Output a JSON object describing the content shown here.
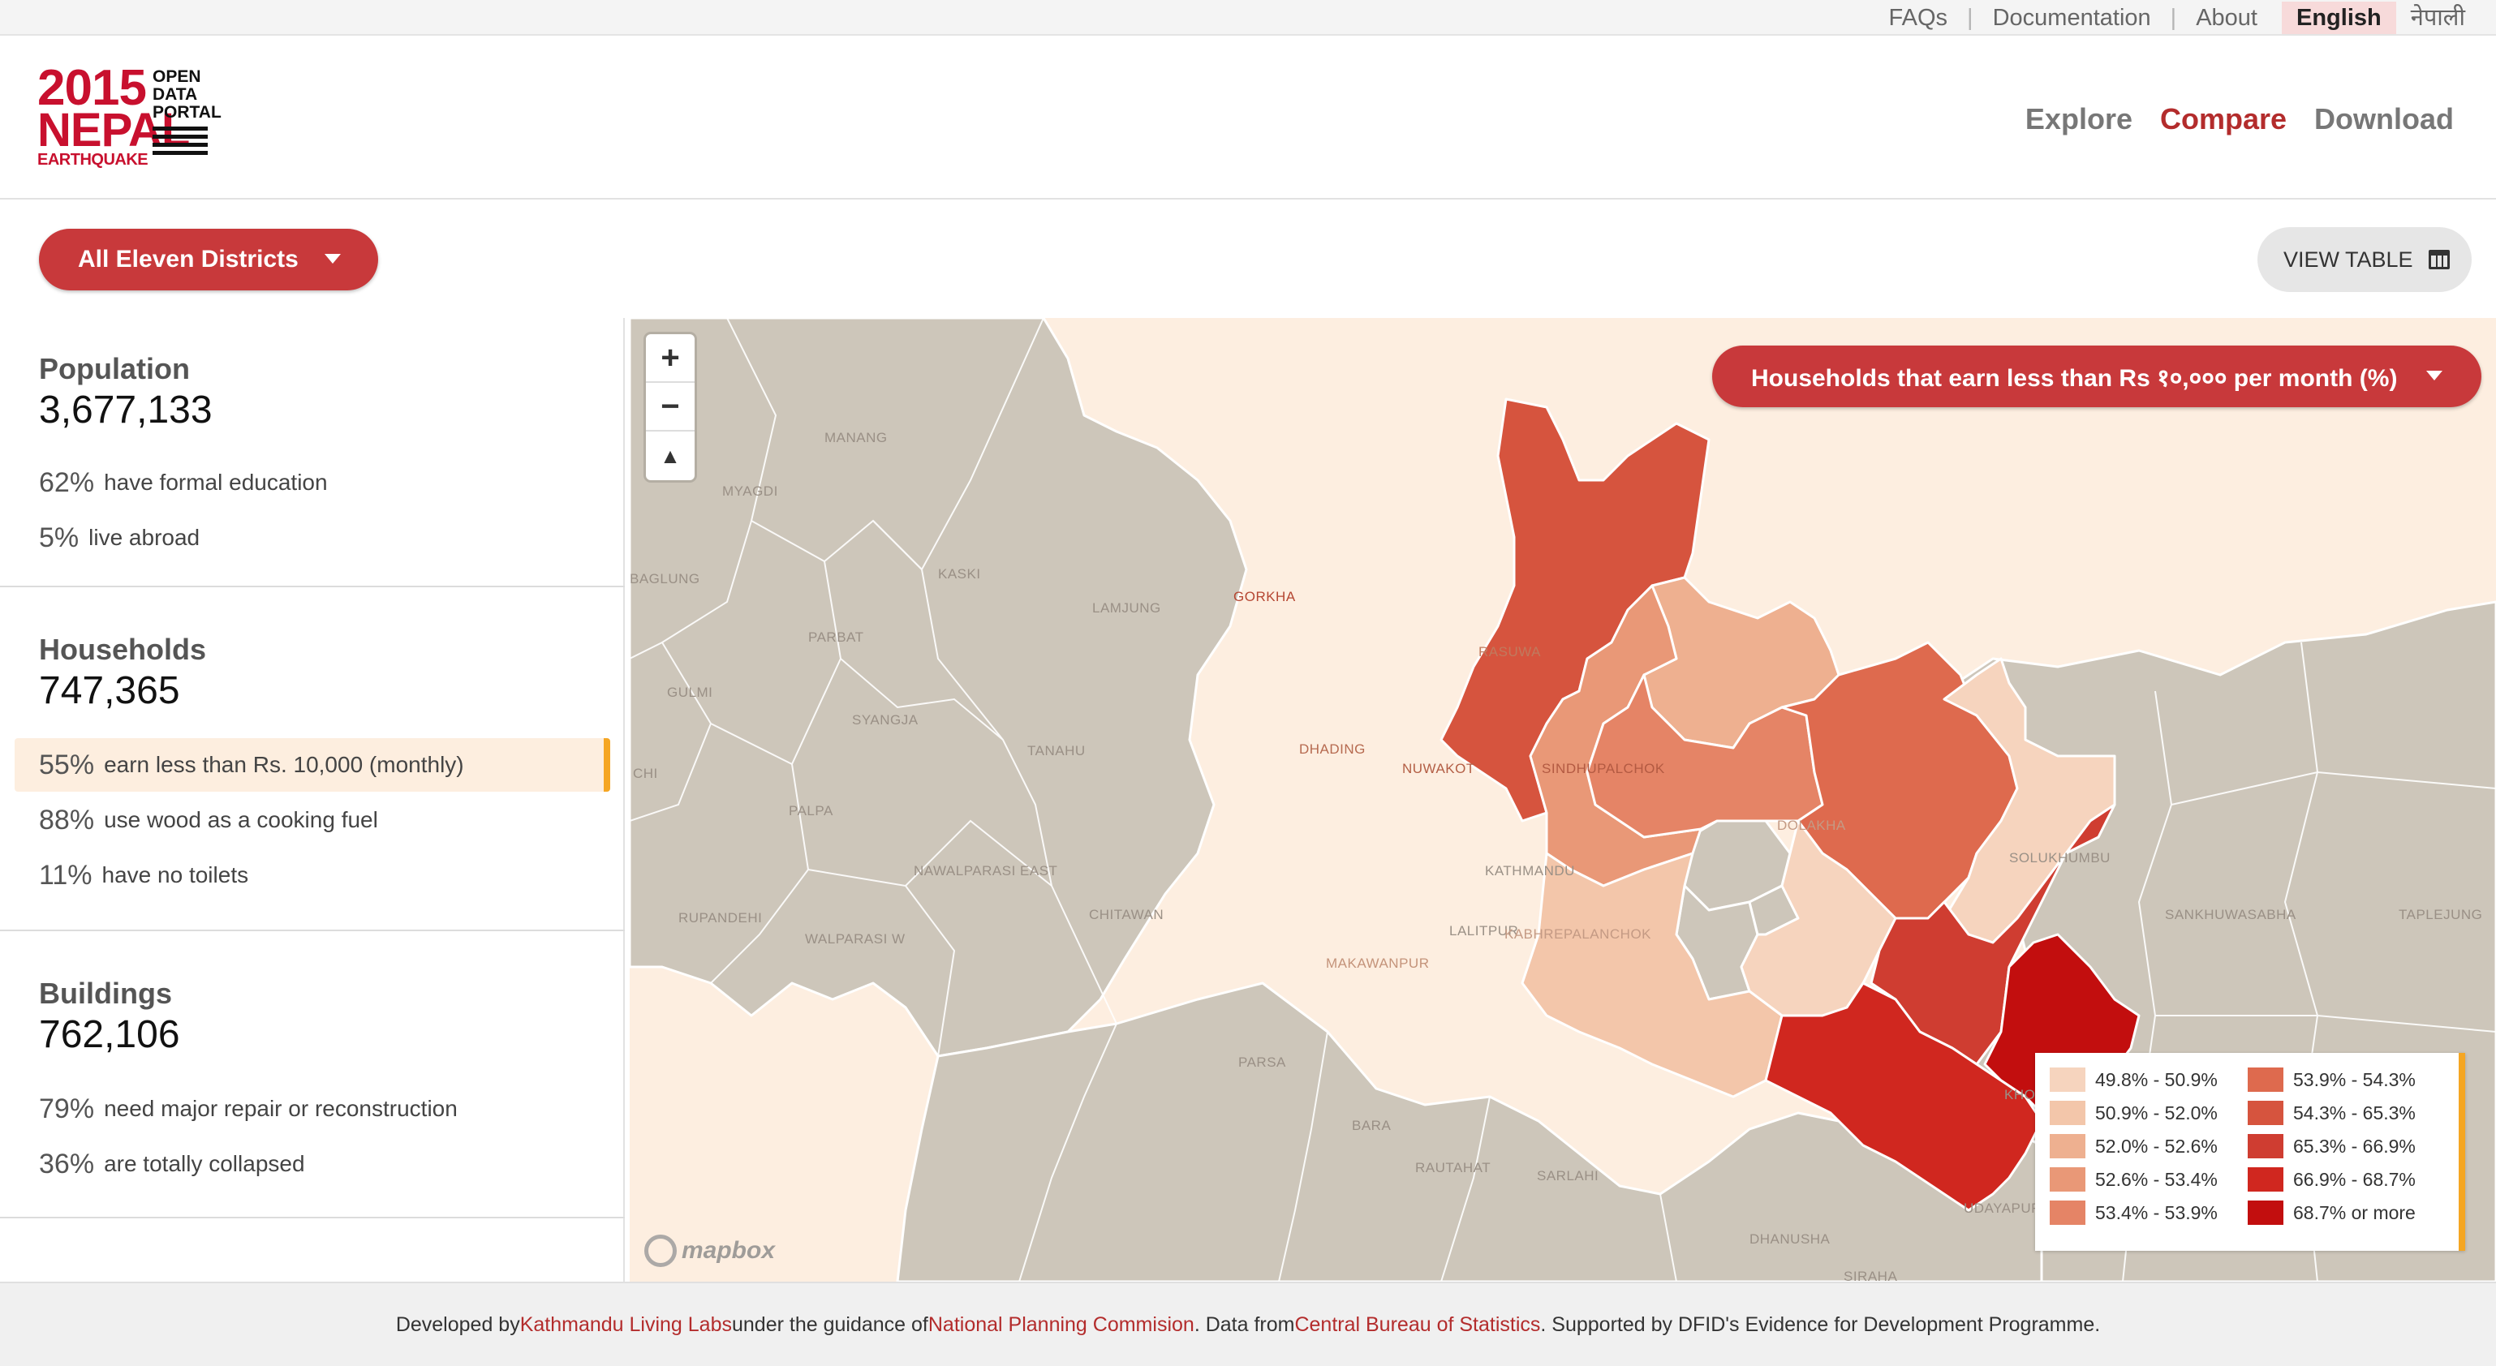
{
  "utility_nav": {
    "links": [
      "FAQs",
      "Documentation",
      "About"
    ],
    "languages": [
      "English",
      "नेपाली"
    ],
    "active_language": "English"
  },
  "logo": {
    "year": "2015",
    "country": "NEPAL",
    "event": "EARTHQUAKE",
    "line1": "OPEN",
    "line2": "DATA",
    "line3": "PORTAL"
  },
  "main_nav": {
    "items": [
      "Explore",
      "Compare",
      "Download"
    ],
    "active": "Compare"
  },
  "toolbar": {
    "district_select": "All Eleven Districts",
    "view_table": "VIEW TABLE"
  },
  "sections": {
    "population": {
      "title": "Population",
      "value": "3,677,133",
      "stats": [
        {
          "pct": "62%",
          "label": "have formal education"
        },
        {
          "pct": "5%",
          "label": "live abroad"
        }
      ]
    },
    "households": {
      "title": "Households",
      "value": "747,365",
      "stats": [
        {
          "pct": "55%",
          "label": "earn less than Rs. 10,000 (monthly)",
          "active": true
        },
        {
          "pct": "88%",
          "label": "use wood as a cooking fuel"
        },
        {
          "pct": "11%",
          "label": "have no toilets"
        }
      ]
    },
    "buildings": {
      "title": "Buildings",
      "value": "762,106",
      "stats": [
        {
          "pct": "79%",
          "label": "need major repair or reconstruction"
        },
        {
          "pct": "36%",
          "label": "are totally collapsed"
        }
      ]
    }
  },
  "map": {
    "indicator": "Households that earn less than Rs १०,००० per month (%)",
    "attribution": "mapbox",
    "zoom_in": "+",
    "zoom_out": "−",
    "compass": "▲",
    "district_labels": {
      "manang": "MANANG",
      "myagdi": "MYAGDI",
      "baglung": "BAGLUNG",
      "kaski": "KASKI",
      "lamjung": "LAMJUNG",
      "parbat": "PARBAT",
      "gulmi": "GULMI",
      "syangja": "SYANGJA",
      "tanahu": "TANAHU",
      "arghakhanchi": "CHI",
      "palpa": "PALPA",
      "nawalparasi": "NAWALPARASI EAST",
      "chitawan": "CHITAWAN",
      "rupandehi": "RUPANDEHI",
      "nawalparasi_w": "WALPARASI W",
      "gorkha": "GORKHA",
      "rasuwa": "RASUWA",
      "dhading": "DHADING",
      "nuwakot": "NUWAKOT",
      "sindhupalchok": "SINDHUPALCHOK",
      "dolakha": "DOLAKHA",
      "solukhumbu": "SOLUKHUMBU",
      "kathmandu": "KATHMANDU",
      "lalitpur": "LALITPUR",
      "kavre": "KABHREPALANCHOK",
      "makawanpur": "MAKAWANPUR",
      "sankhuwasabha": "SANKHUWASABHA",
      "taplejung": "TAPLEJUNG",
      "parsa": "PARSA",
      "bara": "BARA",
      "rautahat": "RAUTAHAT",
      "sarlahi": "SARLAHI",
      "udayapur": "UDAYAPUR",
      "dhanusha": "DHANUSHA",
      "siraha": "SIRAHA",
      "bhojpur": "KHO"
    }
  },
  "legend": [
    {
      "label": "49.8% - 50.9%",
      "color": "#f6d4be"
    },
    {
      "label": "50.9% - 52.0%",
      "color": "#f3c6aa"
    },
    {
      "label": "52.0% - 52.6%",
      "color": "#eeb090"
    },
    {
      "label": "52.6% - 53.4%",
      "color": "#e99877"
    },
    {
      "label": "53.4% - 53.9%",
      "color": "#e58466"
    },
    {
      "label": "53.9% - 54.3%",
      "color": "#de6a4e"
    },
    {
      "label": "54.3% - 65.3%",
      "color": "#d6543e"
    },
    {
      "label": "65.3% - 66.9%",
      "color": "#cf3d31"
    },
    {
      "label": "66.9% - 68.7%",
      "color": "#d0271f"
    },
    {
      "label": "68.7% or more",
      "color": "#c20e0e"
    }
  ],
  "footer": {
    "p1": "Developed by ",
    "l1": "Kathmandu Living Labs",
    "p2": " under the guidance of ",
    "l2": "National Planning Commision",
    "p3": ". Data from ",
    "l3": "Central Bureau of Statistics",
    "p4": ". Supported by DFID's Evidence for Development Programme."
  },
  "colors": {
    "accent": "#c8393b",
    "highlight": "#f5a623",
    "map_background": "#fdeee0",
    "non_affected": "#cdc6ba"
  }
}
